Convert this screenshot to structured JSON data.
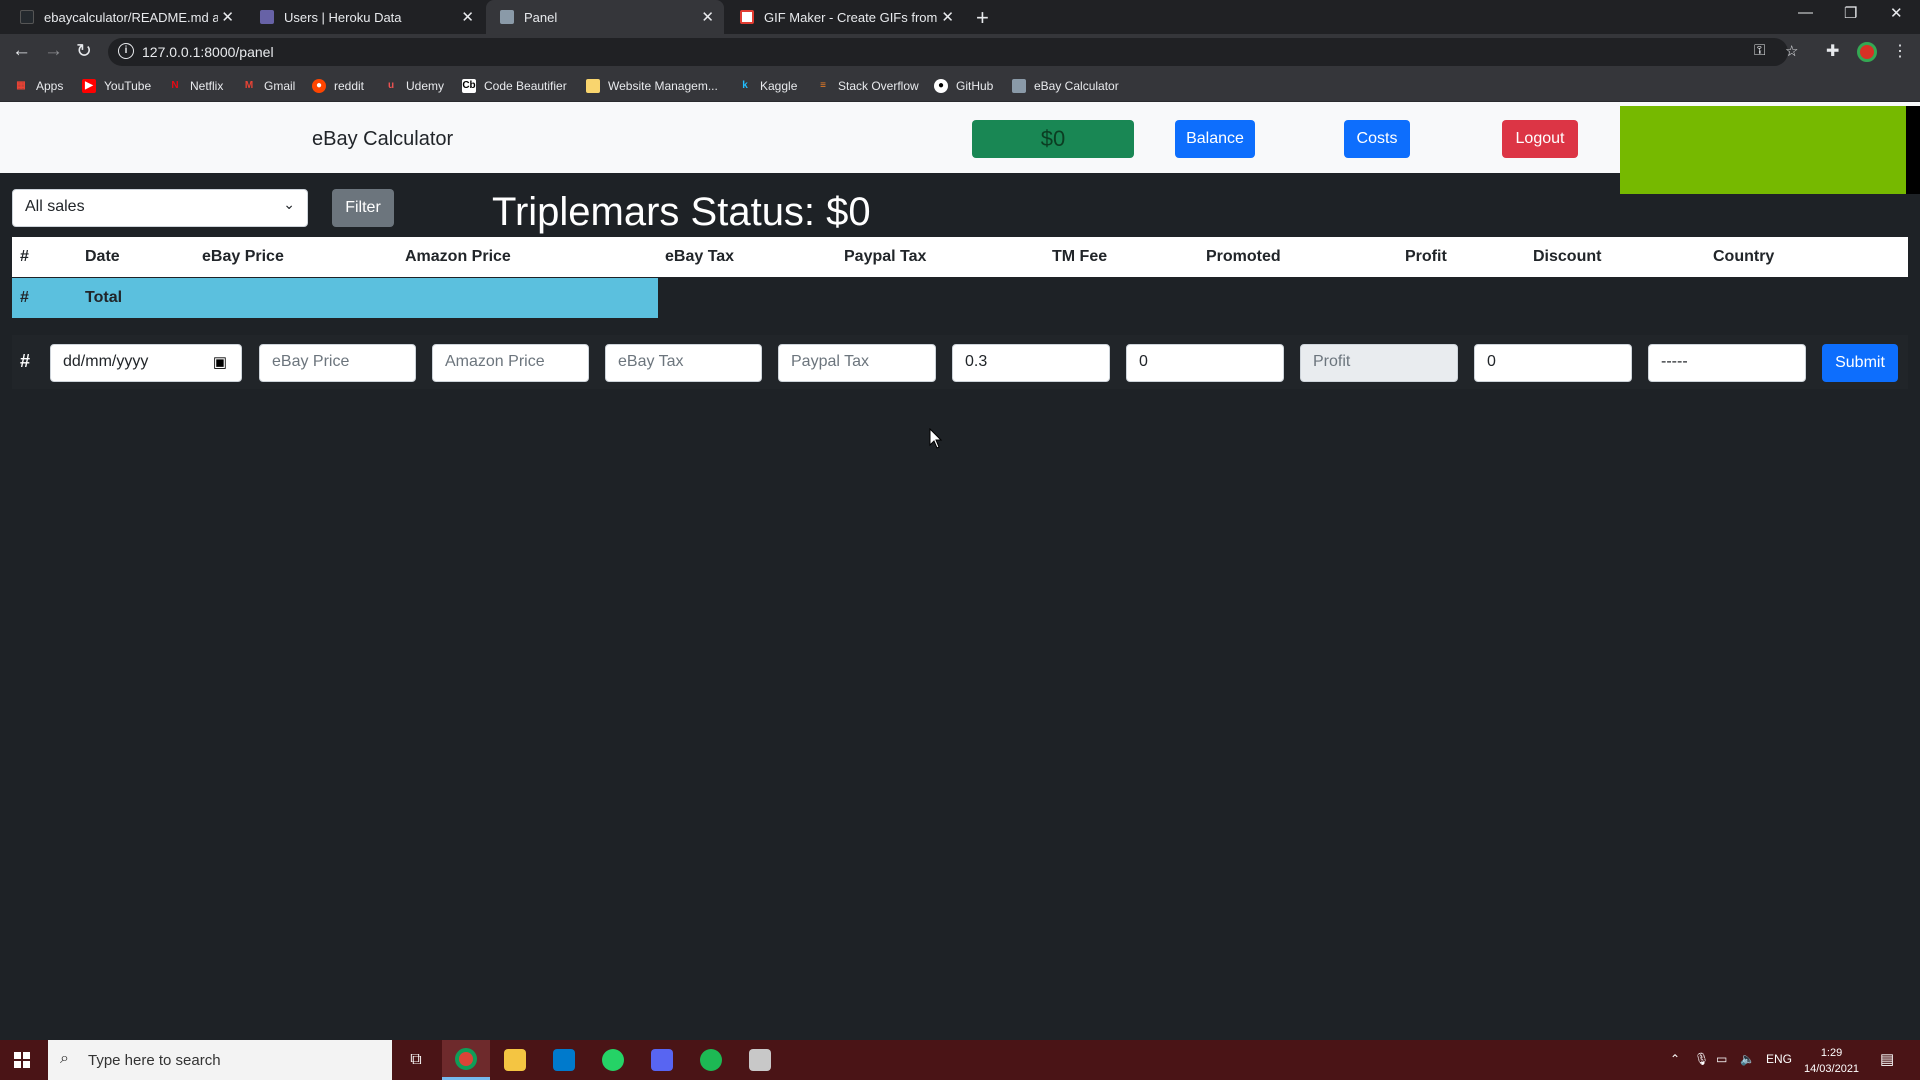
{
  "browser": {
    "tabs": [
      {
        "title": "ebaycalculator/README.md at m",
        "active": false
      },
      {
        "title": "Users | Heroku Data",
        "active": false
      },
      {
        "title": "Panel",
        "active": true
      },
      {
        "title": "GIF Maker - Create GIFs from Vid",
        "active": false
      }
    ],
    "url": "127.0.0.1:8000/panel",
    "bookmarks": [
      "Apps",
      "YouTube",
      "Netflix",
      "Gmail",
      "reddit",
      "Udemy",
      "Code Beautifier",
      "Website Managem...",
      "Kaggle",
      "Stack Overflow",
      "GitHub",
      "eBay Calculator"
    ]
  },
  "navbar": {
    "brand": "eBay Calculator",
    "balance_badge": "$0",
    "balance_label": "Balance",
    "costs_label": "Costs",
    "logout_label": "Logout"
  },
  "filter": {
    "selected": "All sales",
    "button_label": "Filter"
  },
  "status_title": "Triplemars Status: $0",
  "table": {
    "headers": [
      "#",
      "Date",
      "eBay Price",
      "Amazon Price",
      "eBay Tax",
      "Paypal Tax",
      "TM Fee",
      "Promoted",
      "Profit",
      "Discount",
      "Country"
    ],
    "total_row": {
      "hash": "#",
      "label": "Total"
    }
  },
  "form": {
    "hash": "#",
    "date_placeholder": "dd/mm/yyyy",
    "ebay_price_placeholder": "eBay Price",
    "amazon_price_placeholder": "Amazon Price",
    "ebay_tax_placeholder": "eBay Tax",
    "paypal_tax_placeholder": "Paypal Tax",
    "tm_fee_value": "0.3",
    "promoted_value": "0",
    "profit_placeholder": "Profit",
    "discount_value": "0",
    "country_value": "-----",
    "submit_label": "Submit"
  },
  "taskbar": {
    "search_placeholder": "Type here to search",
    "language": "ENG",
    "time": "1:29",
    "date": "14/03/2021"
  },
  "colors": {
    "navbar_bg": "#f8f9fa",
    "page_bg": "#1e2226",
    "primary": "#0d6efd",
    "success": "#198754",
    "danger": "#dc3545",
    "info": "#5bc0de",
    "accent_box": "#76b900"
  }
}
